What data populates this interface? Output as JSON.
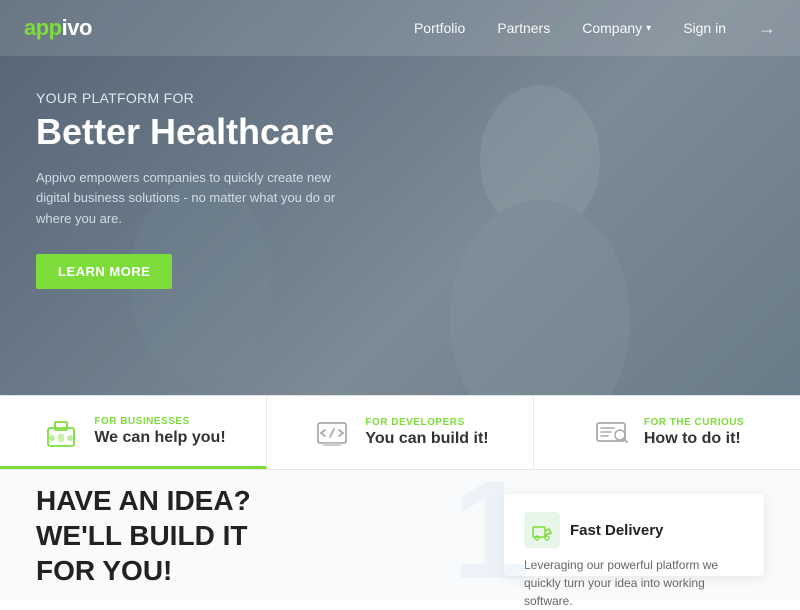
{
  "nav": {
    "logo_app": "app",
    "logo_ivo": "ivo",
    "links": [
      {
        "label": "Portfolio",
        "name": "nav-portfolio"
      },
      {
        "label": "Partners",
        "name": "nav-partners"
      },
      {
        "label": "Company",
        "name": "nav-company",
        "has_dropdown": true
      },
      {
        "label": "Sign in",
        "name": "nav-signin"
      }
    ],
    "icon": "→"
  },
  "hero": {
    "subtitle": "YOUR PLATFORM FOR",
    "title": "Better Healthcare",
    "description": "Appivo empowers companies to quickly create new digital business solutions - no matter what you do or where you are.",
    "cta_label": "LEARN MORE"
  },
  "feature_tabs": [
    {
      "name": "tab-businesses",
      "label": "FOR BUSINESSES",
      "desc": "We can help you!",
      "active": true
    },
    {
      "name": "tab-developers",
      "label": "FOR DEVELOPERS",
      "desc": "You can build it!",
      "active": false
    },
    {
      "name": "tab-curious",
      "label": "FOR THE CURIOUS",
      "desc": "How to do it!",
      "active": false
    }
  ],
  "bottom": {
    "headline_line1": "HAVE AN IDEA?",
    "headline_line2": "WE'LL BUILD IT",
    "headline_line3": "FOR YOU!",
    "card_title": "Fast Delivery",
    "card_desc": "Leveraging our powerful platform we quickly turn your idea into working software.",
    "watermark": "1"
  }
}
